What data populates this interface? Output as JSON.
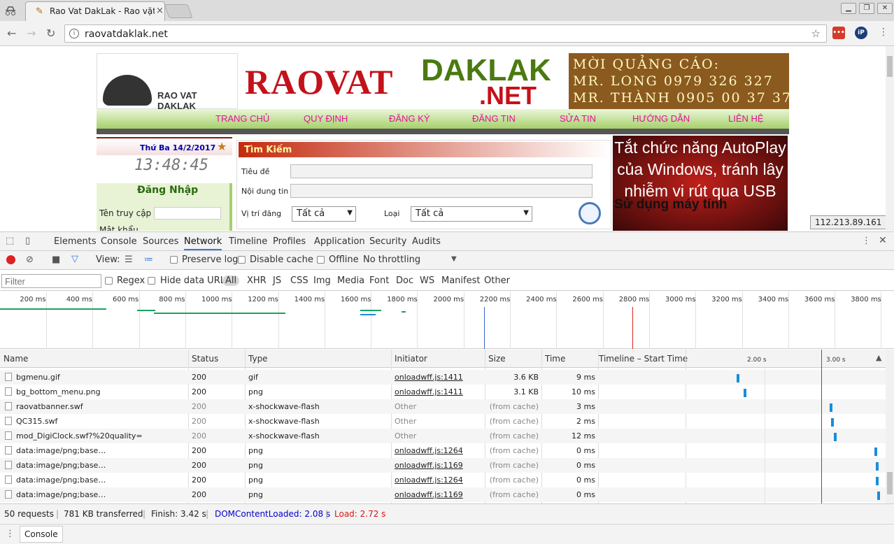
{
  "browser": {
    "tab_title": "Rao Vat DakLak - Rao vặt",
    "url": "raovatdaklak.net"
  },
  "site": {
    "logo_text": "RAO VAT DAKLAK",
    "banner_rao": "RAOVAT",
    "banner_daklak": "DAKLAK",
    "banner_net": ".NET",
    "ad_lines": [
      "MỜI QUẢNG CÁO:",
      "MR. LONG 0979 326 327",
      "MR. THÀNH 0905 00 37 37"
    ],
    "menu": [
      "TRANG CHỦ",
      "QUY ĐỊNH",
      "ĐĂNG KÝ",
      "ĐĂNG TIN",
      "SỬA TIN",
      "HƯỚNG DẪN",
      "LIÊN HỆ"
    ],
    "date": "Thứ Ba 14/2/2017",
    "clock": "13:48:45",
    "login_title": "Đăng Nhập",
    "login_user": "Tên truy cập",
    "login_pass": "Mật khẩu",
    "search_title": "Tìm Kiếm",
    "search_title_label": "Tiêu đề",
    "search_content_label": "Nội dung tin",
    "search_location_label": "Vị trí đăng",
    "search_location_value": "Tất cả",
    "search_type_label": "Loại",
    "search_type_value": "Tất cả",
    "video_text": "Tắt chức năng AutoPlay của Windows, tránh lây nhiễm vi rút qua USB",
    "video_overlay": "Sử dụng máy tính",
    "ip": "112.213.89.161"
  },
  "devtools": {
    "tabs": [
      "Elements",
      "Console",
      "Sources",
      "Network",
      "Timeline",
      "Profiles",
      "Application",
      "Security",
      "Audits"
    ],
    "active_tab": "Network",
    "view_label": "View:",
    "preserve_log": "Preserve log",
    "disable_cache": "Disable cache",
    "offline": "Offline",
    "throttling": "No throttling",
    "filter_placeholder": "Filter",
    "regex": "Regex",
    "hide_data_urls": "Hide data URLs",
    "filter_types": [
      "All",
      "XHR",
      "JS",
      "CSS",
      "Img",
      "Media",
      "Font",
      "Doc",
      "WS",
      "Manifest",
      "Other"
    ],
    "overview_ticks": [
      "200 ms",
      "400 ms",
      "600 ms",
      "800 ms",
      "1000 ms",
      "1200 ms",
      "1400 ms",
      "1600 ms",
      "1800 ms",
      "2000 ms",
      "2200 ms",
      "2400 ms",
      "2600 ms",
      "2800 ms",
      "3000 ms",
      "3200 ms",
      "3400 ms",
      "3600 ms",
      "3800 ms"
    ],
    "columns": [
      "Name",
      "Status",
      "Type",
      "Initiator",
      "Size",
      "Time",
      "Timeline – Start Time"
    ],
    "timeline_ticks": [
      "2.00 s",
      "3.00 s"
    ],
    "requests": [
      {
        "name": "bgmenu.gif",
        "status": "200",
        "type": "gif",
        "initiator": "onloadwff.js:1411",
        "size": "3.6 KB",
        "time": "9 ms"
      },
      {
        "name": "bg_bottom_menu.png",
        "status": "200",
        "type": "png",
        "initiator": "onloadwff.js:1411",
        "size": "3.1 KB",
        "time": "10 ms"
      },
      {
        "name": "raovatbanner.swf",
        "status": "200",
        "type": "x-shockwave-flash",
        "initiator": "Other",
        "size": "(from cache)",
        "time": "3 ms"
      },
      {
        "name": "QC315.swf",
        "status": "200",
        "type": "x-shockwave-flash",
        "initiator": "Other",
        "size": "(from cache)",
        "time": "2 ms"
      },
      {
        "name": "mod_DigiClock.swf?%20quality=",
        "status": "200",
        "type": "x-shockwave-flash",
        "initiator": "Other",
        "size": "(from cache)",
        "time": "12 ms"
      },
      {
        "name": "data:image/png;base…",
        "status": "200",
        "type": "png",
        "initiator": "onloadwff.js:1264",
        "size": "(from cache)",
        "time": "0 ms"
      },
      {
        "name": "data:image/png;base…",
        "status": "200",
        "type": "png",
        "initiator": "onloadwff.js:1169",
        "size": "(from cache)",
        "time": "0 ms"
      },
      {
        "name": "data:image/png;base…",
        "status": "200",
        "type": "png",
        "initiator": "onloadwff.js:1264",
        "size": "(from cache)",
        "time": "0 ms"
      },
      {
        "name": "data:image/png;base…",
        "status": "200",
        "type": "png",
        "initiator": "onloadwff.js:1169",
        "size": "(from cache)",
        "time": "0 ms"
      }
    ],
    "summary": {
      "requests": "50 requests",
      "transferred": "781 KB transferred",
      "finish": "Finish: 3.42 s",
      "dom": "DOMContentLoaded: 2.08 s",
      "load": "Load: 2.72 s"
    },
    "drawer_tab": "Console"
  },
  "colors": {
    "accent": "#3879d9",
    "record": "#dd2222",
    "dom_blue": "#0000cc",
    "load_red": "#dd1111"
  }
}
